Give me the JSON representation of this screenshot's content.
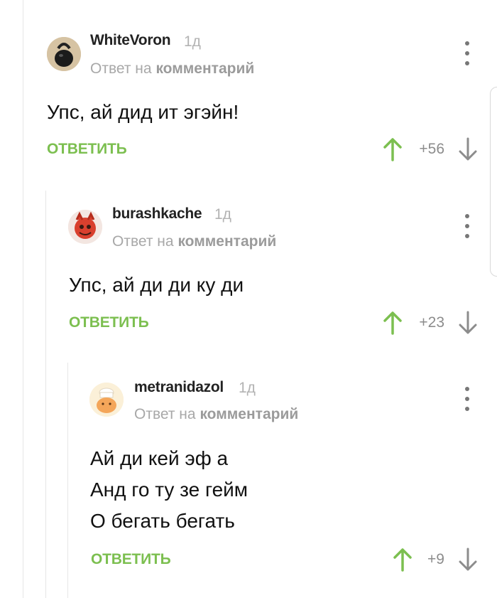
{
  "comments": [
    {
      "author": "WhiteVoron",
      "time": "1д",
      "reply_prefix": "Ответ на",
      "reply_target": "комментарий",
      "lines": [
        "Упс, ай дид ит эгэйн!"
      ],
      "reply_label": "ОТВЕТИТЬ",
      "score": "+56",
      "avatar_icon": "kettlebell-avatar"
    },
    {
      "author": "burashkache",
      "time": "1д",
      "reply_prefix": "Ответ на",
      "reply_target": "комментарий",
      "lines": [
        "Упс, ай ди ди ку ди"
      ],
      "reply_label": "ОТВЕТИТЬ",
      "score": "+23",
      "avatar_icon": "red-creature-avatar"
    },
    {
      "author": "metranidazol",
      "time": "1д",
      "reply_prefix": "Ответ на",
      "reply_target": "комментарий",
      "lines": [
        "Ай ди кей эф а",
        "Анд го ту зе гейм",
        "О бегать бегать"
      ],
      "reply_label": "ОТВЕТИТЬ",
      "score": "+9",
      "avatar_icon": "chef-avatar"
    }
  ],
  "colors": {
    "accent_green": "#7cbf50",
    "meta_gray": "#a8a8a8",
    "thread_line": "#e6e6e6"
  }
}
